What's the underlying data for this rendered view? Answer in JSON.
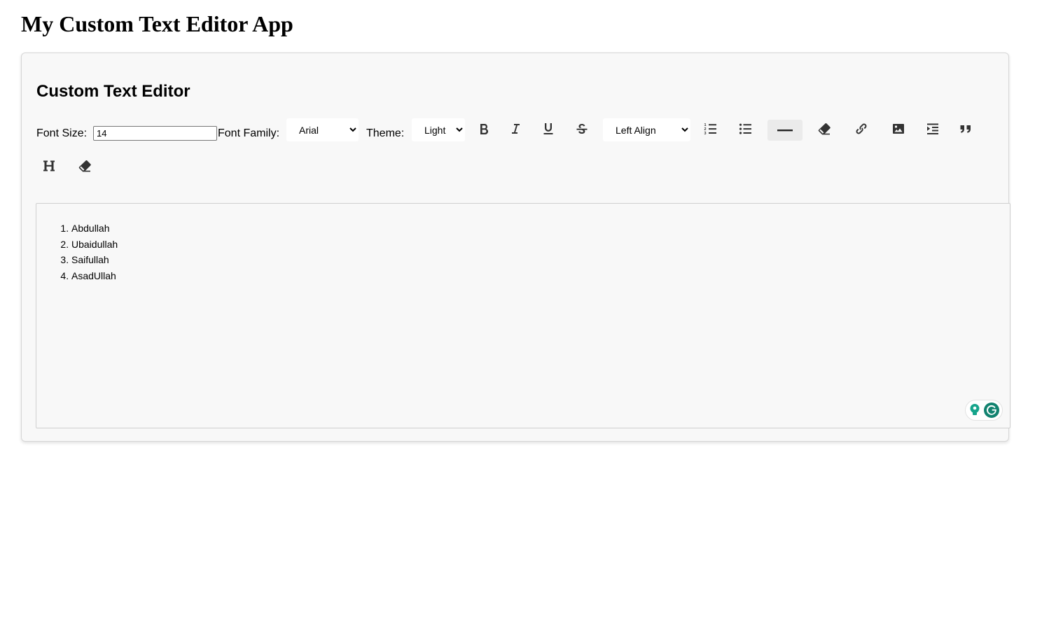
{
  "app": {
    "title": "My Custom Text Editor App"
  },
  "editor": {
    "heading": "Custom Text Editor",
    "toolbar": {
      "font_size_label": "Font Size:",
      "font_size_value": "14",
      "font_family_label": "Font Family:",
      "font_family_selected": "Arial",
      "theme_label": "Theme:",
      "theme_selected": "Light",
      "align_selected": "Left Align",
      "buttons": [
        {
          "id": "bold",
          "icon": "bold-icon"
        },
        {
          "id": "italic",
          "icon": "italic-icon"
        },
        {
          "id": "underline",
          "icon": "underline-icon"
        },
        {
          "id": "strikethrough",
          "icon": "strikethrough-icon"
        },
        {
          "id": "ordered-list",
          "icon": "ordered-list-icon"
        },
        {
          "id": "unordered-list",
          "icon": "unordered-list-icon"
        },
        {
          "id": "horizontal-rule",
          "icon": "horizontal-rule-icon",
          "active": true
        },
        {
          "id": "eraser",
          "icon": "eraser-icon"
        },
        {
          "id": "link",
          "icon": "link-icon"
        },
        {
          "id": "image",
          "icon": "image-icon"
        },
        {
          "id": "indent",
          "icon": "indent-icon"
        },
        {
          "id": "blockquote",
          "icon": "quote-icon"
        },
        {
          "id": "heading",
          "icon": "heading-icon"
        },
        {
          "id": "clear-format",
          "icon": "eraser-icon"
        }
      ]
    },
    "content": {
      "list_items": [
        "Abdullah",
        "Ubaidullah",
        "Saifullah",
        "AsadUllah"
      ]
    }
  },
  "colors": {
    "card_background": "#f8f8f8",
    "icon": "#333333",
    "grammarly_green": "#15a48b",
    "grammarly_dark": "#11826f"
  }
}
